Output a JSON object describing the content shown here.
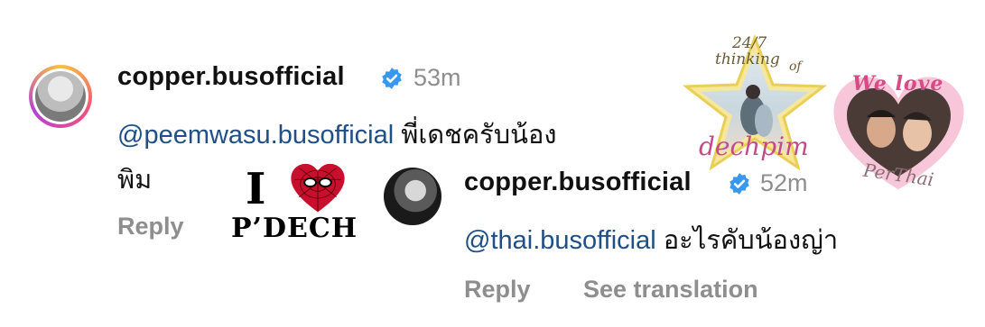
{
  "comment1": {
    "username": "copper.busofficial",
    "time": "53m",
    "mention": "@peemwasu.busofficial",
    "text_line1": "พี่เดชครับน้อง",
    "text_line2": "พิม",
    "reply_label": "Reply"
  },
  "reply1": {
    "username": "copper.busofficial",
    "time": "52m",
    "mention": "@thai.busofficial",
    "text": "อะไรคับน้องญ่า",
    "reply_label": "Reply",
    "translate_label": "See translation"
  },
  "stickers": {
    "love_letter": "I",
    "love_name": "P’DECH",
    "star_top1": "24/7",
    "star_top2": "thinking",
    "star_top3": "of",
    "star_bottom": "dechpim",
    "heart_top": "We love",
    "heart_bottom": "PerThai"
  },
  "colors": {
    "verified_blue": "#3897f0",
    "mention_blue": "#1f4f86",
    "muted_gray": "#8e8e8e"
  }
}
